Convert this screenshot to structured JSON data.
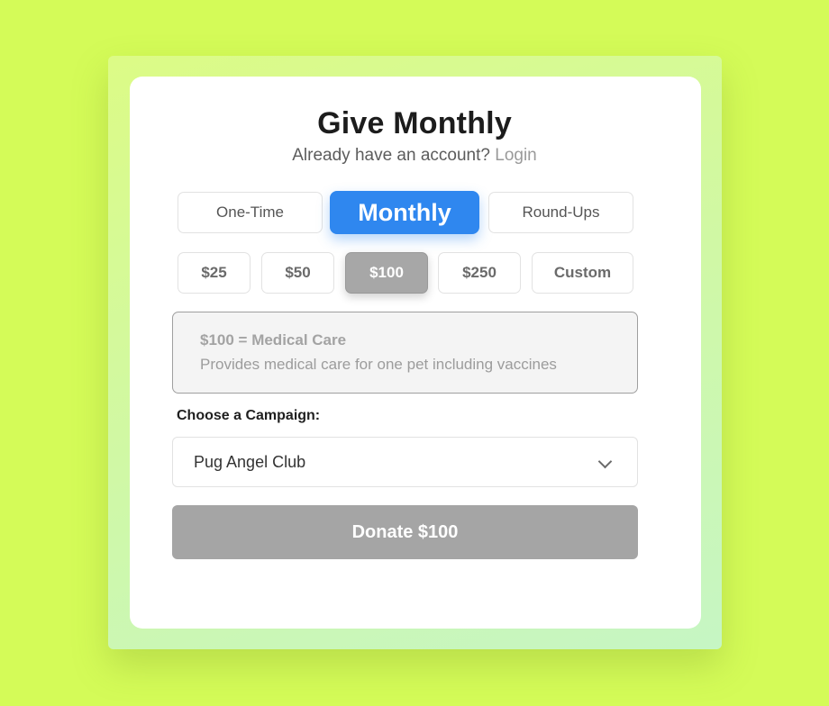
{
  "header": {
    "title": "Give Monthly",
    "account_prompt": "Already have an account?",
    "login_link": "Login"
  },
  "frequency_tabs": [
    {
      "label": "One-Time",
      "selected": false
    },
    {
      "label": "Monthly",
      "selected": true
    },
    {
      "label": "Round-Ups",
      "selected": false
    }
  ],
  "amounts": [
    {
      "label": "$25",
      "selected": false
    },
    {
      "label": "$50",
      "selected": false
    },
    {
      "label": "$100",
      "selected": true
    },
    {
      "label": "$250",
      "selected": false
    },
    {
      "label": "Custom",
      "selected": false
    }
  ],
  "impact": {
    "title": "$100 = Medical Care",
    "description": "Provides medical care for one pet including vaccines"
  },
  "campaign": {
    "label": "Choose a Campaign:",
    "selected_value": "Pug Angel Club",
    "icon": "chevron-down-icon"
  },
  "donate_button": {
    "label": "Donate $100"
  },
  "colors": {
    "page_background": "#d4fb58",
    "primary_accent": "#2f87ef",
    "selected_amount": "#a7a7a7",
    "donate_button": "#a5a5a5"
  }
}
